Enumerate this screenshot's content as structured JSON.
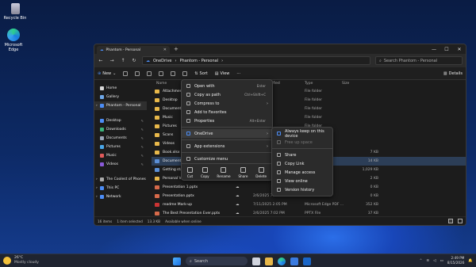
{
  "desktop": {
    "icons": [
      {
        "label": "Recycle Bin"
      },
      {
        "label": "Microsoft Edge"
      }
    ]
  },
  "window": {
    "tab_title": "Phantom - Personal",
    "breadcrumb": [
      "OneDrive",
      "Phantom - Personal"
    ],
    "search_placeholder": "Search Phantom - Personal",
    "toolbar": {
      "new": "New",
      "sort": "Sort",
      "view": "View",
      "more": "···",
      "details": "Details"
    }
  },
  "sidebar": {
    "items": [
      "Home",
      "Gallery",
      "Phantom - Personal",
      "Desktop",
      "Downloads",
      "Documents",
      "Pictures",
      "Music",
      "Videos",
      "The Coolest of Phones",
      "This PC",
      "Network"
    ]
  },
  "columns": {
    "name": "Name",
    "modified": "ified",
    "type": "Type",
    "size": "Size"
  },
  "files": [
    {
      "name": "Attachments",
      "modified": "6:59 PM",
      "type": "File folder",
      "size": ""
    },
    {
      "name": "Desktop",
      "modified": "6:59 PM",
      "type": "File folder",
      "size": ""
    },
    {
      "name": "Documents",
      "modified": "6:59 PM",
      "type": "File folder",
      "size": ""
    },
    {
      "name": "Music",
      "modified": "6:59 PM",
      "type": "File folder",
      "size": ""
    },
    {
      "name": "Pictures",
      "modified": "6:59 PM",
      "type": "File folder",
      "size": ""
    },
    {
      "name": "Scans",
      "modified": "6:59 PM",
      "type": "File folder",
      "size": ""
    },
    {
      "name": "Videos",
      "modified": "6:59 PM",
      "type": "File folder",
      "size": ""
    },
    {
      "name": "Book.xlsx",
      "modified": "",
      "type": "",
      "size": "7 KB"
    },
    {
      "name": "Document.docx",
      "modified": "",
      "type": "",
      "size": "14 KB"
    },
    {
      "name": "Getting started",
      "modified": "",
      "type": "",
      "size": "1,029 KB"
    },
    {
      "name": "Personal Vault",
      "modified": "",
      "type": "",
      "size": "2 KB"
    },
    {
      "name": "Presentation 1.pptx",
      "modified": "",
      "type": "",
      "size": "0 KB"
    },
    {
      "name": "Presentation.pptx",
      "modified": "2/6/2025 7:02 PM",
      "type": "PPTX File",
      "size": "0 KB"
    },
    {
      "name": "readme Mark-up",
      "modified": "7/11/2025 2:05 PM",
      "type": "Microsoft Edge PDF ...",
      "size": "352 KB"
    },
    {
      "name": "The Best Presentation Ever.pptx",
      "modified": "2/6/2025 7:02 PM",
      "type": "PPTX File",
      "size": "37 KB"
    }
  ],
  "status": {
    "count": "16 items",
    "selected": "1 item selected",
    "size": "13.3 KB",
    "availability": "Available when online"
  },
  "context_menu": {
    "items": [
      {
        "label": "Open with",
        "shortcut": "Enter"
      },
      {
        "label": "Copy as path",
        "shortcut": "Ctrl+Shift+C"
      },
      {
        "label": "Compress to",
        "shortcut": ""
      },
      {
        "label": "Add to Favorites",
        "shortcut": ""
      },
      {
        "label": "Properties",
        "shortcut": "Alt+Enter"
      },
      {
        "label": "OneDrive",
        "shortcut": ""
      },
      {
        "label": "App extensions",
        "shortcut": ""
      },
      {
        "label": "Customize menu",
        "shortcut": ""
      }
    ],
    "quick": [
      "Cut",
      "Copy",
      "Rename",
      "Share",
      "Delete"
    ]
  },
  "onedrive_submenu": {
    "items": [
      "Always keep on this device",
      "Free up space",
      "Share",
      "Copy Link",
      "Manage access",
      "View online",
      "Version history"
    ]
  },
  "taskbar": {
    "temp": "26°C",
    "weather": "Mostly cloudy",
    "search": "Search",
    "time": "2:49 PM",
    "date": "8/15/2026"
  },
  "colors": {
    "accent": "#4c8df6",
    "folder": "#e8b84a",
    "selection": "#2c3e57"
  }
}
